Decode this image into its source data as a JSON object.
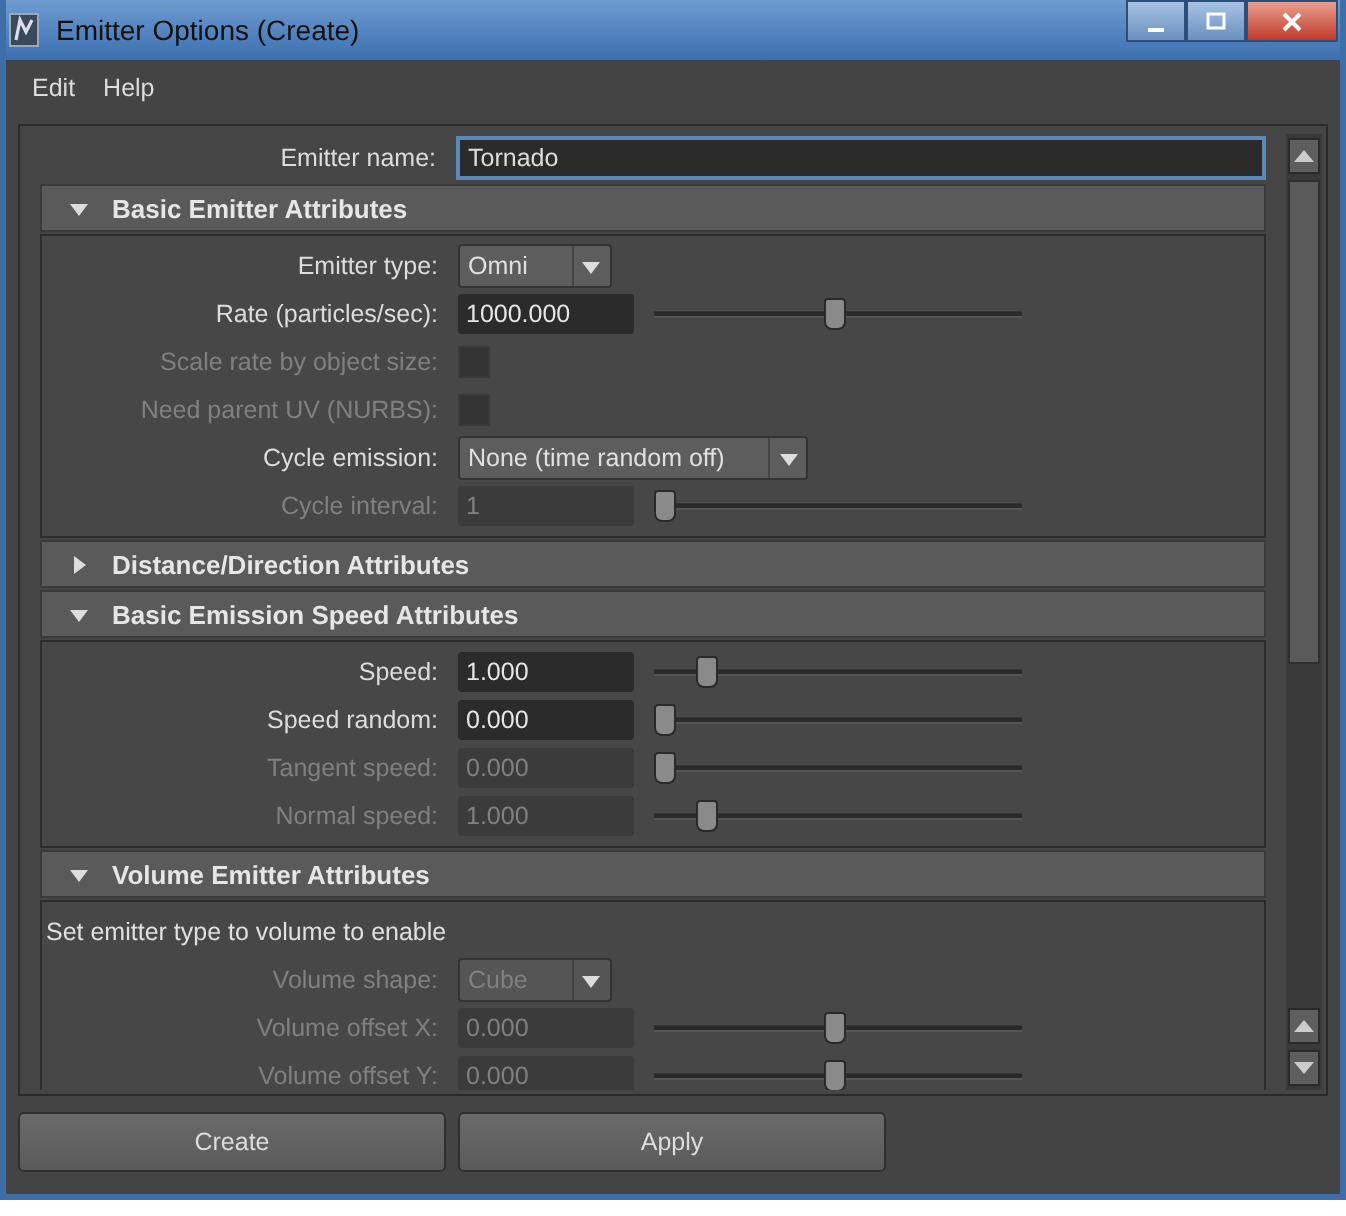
{
  "window": {
    "title": "Emitter Options (Create)"
  },
  "menu": [
    "Edit",
    "Help"
  ],
  "emitter_name": {
    "label": "Emitter name:",
    "value": "Tornado",
    "focused": true
  },
  "sections": [
    {
      "title": "Basic Emitter Attributes",
      "expanded": true,
      "rows": [
        {
          "kind": "dropdown",
          "label": "Emitter type:",
          "value": "Omni",
          "disabled": false
        },
        {
          "kind": "slider",
          "label": "Rate (particles/sec):",
          "value": "1000.000",
          "level": 0.49,
          "disabled": false
        },
        {
          "kind": "checkbox",
          "label": "Scale rate by object size:",
          "checked": false,
          "disabled": true
        },
        {
          "kind": "checkbox",
          "label": "Need parent UV (NURBS):",
          "checked": false,
          "disabled": true
        },
        {
          "kind": "dropdown",
          "label": "Cycle emission:",
          "value": "None (time random off)",
          "disabled": false
        },
        {
          "kind": "slider",
          "label": "Cycle interval:",
          "value": "1",
          "level": 0.0,
          "disabled": true
        }
      ]
    },
    {
      "title": "Distance/Direction Attributes",
      "expanded": false
    },
    {
      "title": "Basic Emission Speed Attributes",
      "expanded": true,
      "rows": [
        {
          "kind": "slider",
          "label": "Speed:",
          "value": "1.000",
          "level": 0.12,
          "disabled": false
        },
        {
          "kind": "slider",
          "label": "Speed random:",
          "value": "0.000",
          "level": 0.0,
          "disabled": false
        },
        {
          "kind": "slider",
          "label": "Tangent speed:",
          "value": "0.000",
          "level": 0.0,
          "disabled": true
        },
        {
          "kind": "slider",
          "label": "Normal speed:",
          "value": "1.000",
          "level": 0.12,
          "disabled": true
        }
      ]
    },
    {
      "title": "Volume Emitter Attributes",
      "expanded": true,
      "rows": [
        {
          "kind": "note",
          "label": "Set emitter type to volume to enable"
        },
        {
          "kind": "dropdown",
          "label": "Volume shape:",
          "value": "Cube",
          "disabled": true
        },
        {
          "kind": "slider",
          "label": "Volume offset X:",
          "value": "0.000",
          "level": 0.49,
          "disabled": true
        },
        {
          "kind": "slider",
          "label": "Volume offset Y:",
          "value": "0.000",
          "level": 0.49,
          "disabled": true
        }
      ]
    }
  ],
  "buttons": [
    "Create",
    "Apply"
  ]
}
